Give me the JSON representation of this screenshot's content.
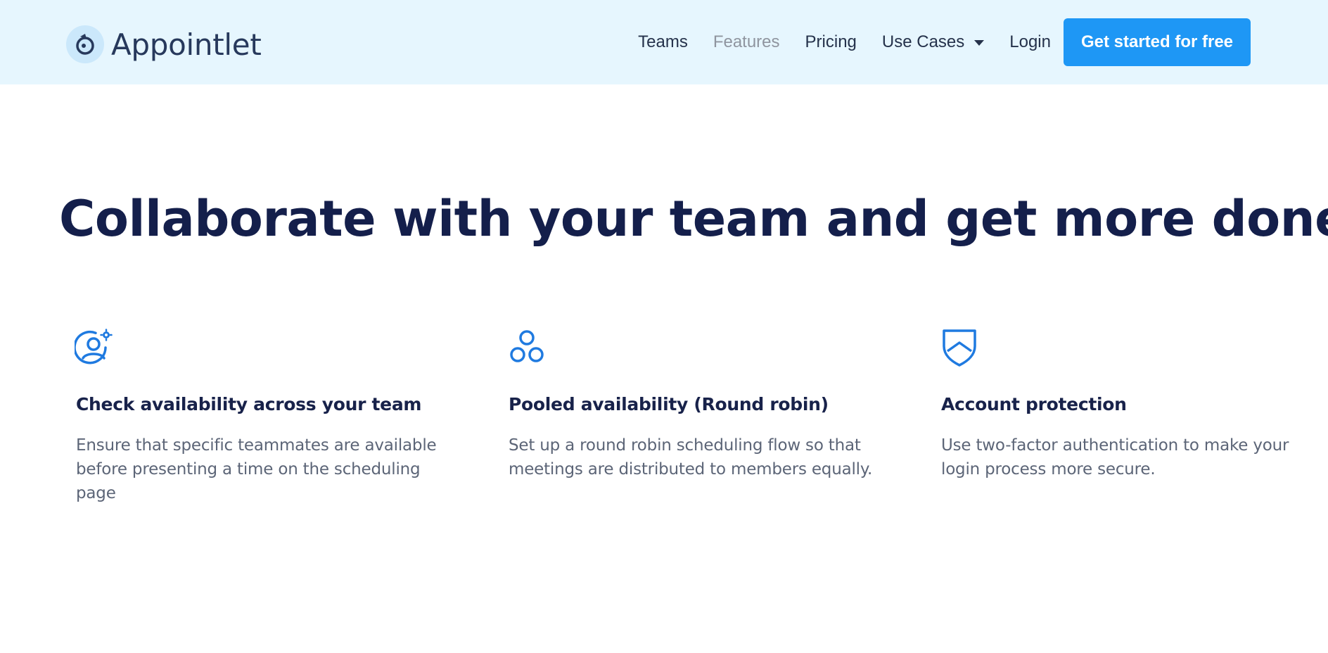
{
  "header": {
    "brand": "Appointlet",
    "nav": [
      {
        "label": "Teams"
      },
      {
        "label": "Features"
      },
      {
        "label": "Pricing"
      },
      {
        "label": "Use Cases"
      },
      {
        "label": "Login"
      }
    ],
    "cta_label": "Get started for free"
  },
  "main": {
    "headline": "Collaborate with your team and get more done",
    "features": [
      {
        "icon": "user-settings-icon",
        "title": "Check availability across your team",
        "description": "Ensure that specific teammates are available before presenting a time on the scheduling page"
      },
      {
        "icon": "three-circles-icon",
        "title": "Pooled availability (Round robin)",
        "description": "Set up a round robin scheduling flow so that meetings are distributed to members equally."
      },
      {
        "icon": "shield-icon",
        "title": "Account protection",
        "description": "Use two-factor authentication to make your login process more secure."
      }
    ]
  },
  "colors": {
    "header_bg": "#e6f6fe",
    "accent": "#1e97f5",
    "icon_blue": "#1f7ae0",
    "heading": "#141f4b",
    "body_text": "#5c6577",
    "nav_muted": "#8f959f"
  }
}
